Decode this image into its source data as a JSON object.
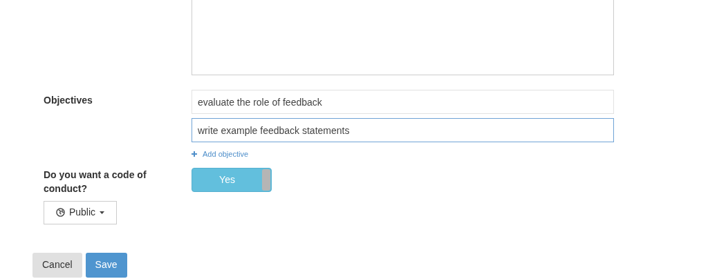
{
  "objectives": {
    "label": "Objectives",
    "items": [
      {
        "value": "evaluate the role of feedback",
        "focused": false
      },
      {
        "value": "write example feedback statements",
        "focused": true
      }
    ],
    "add_label": "Add objective"
  },
  "code_of_conduct": {
    "label": "Do you want a code of conduct?",
    "toggle": {
      "on": true,
      "label": "Yes"
    }
  },
  "visibility": {
    "label": "Public"
  },
  "buttons": [
    {
      "label": "Cancel",
      "kind": "secondary"
    },
    {
      "label": "Save",
      "kind": "primary"
    }
  ]
}
